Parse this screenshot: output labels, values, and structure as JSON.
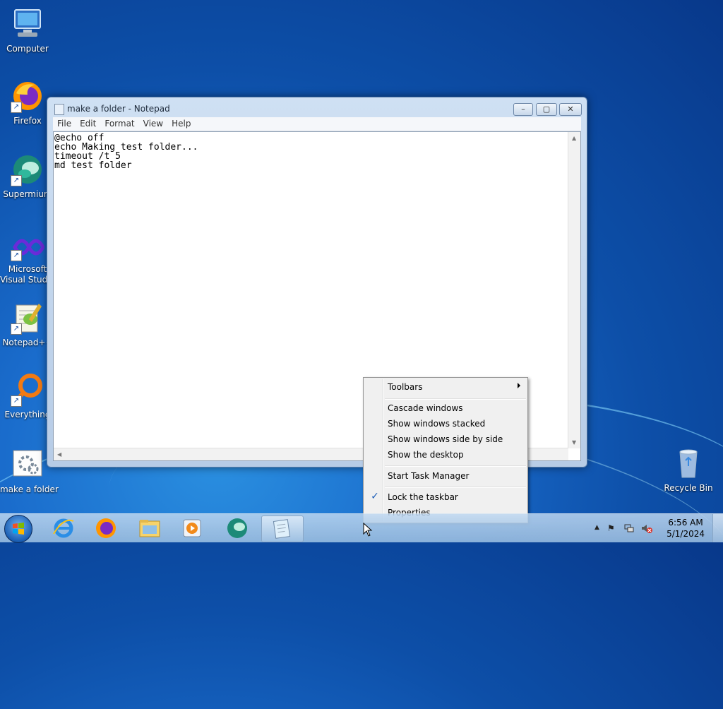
{
  "desktop": {
    "icons": [
      {
        "label": "Computer",
        "icon": "computer-icon"
      },
      {
        "label": "Firefox",
        "icon": "firefox-icon"
      },
      {
        "label": "Supermium",
        "icon": "supermium-icon"
      },
      {
        "label_line1": "Microsoft",
        "label_line2": "Visual Studio",
        "icon": "visual-studio-icon"
      },
      {
        "label": "Notepad++",
        "icon": "notepadpp-icon"
      },
      {
        "label": "Everything",
        "icon": "everything-icon"
      },
      {
        "label": "make a folder",
        "icon": "batch-file-icon"
      },
      {
        "label": "Recycle Bin",
        "icon": "recycle-bin-icon"
      }
    ]
  },
  "notepad": {
    "title": "make a folder - Notepad",
    "menu": [
      "File",
      "Edit",
      "Format",
      "View",
      "Help"
    ],
    "content": "@echo off\necho Making test folder...\ntimeout /t 5\nmd test folder"
  },
  "context_menu": {
    "items": [
      {
        "label": "Toolbars",
        "submenu": true
      },
      {
        "label": "Cascade windows"
      },
      {
        "label": "Show windows stacked"
      },
      {
        "label": "Show windows side by side"
      },
      {
        "label": "Show the desktop"
      },
      {
        "label": "Start Task Manager"
      },
      {
        "label": "Lock the taskbar",
        "checked": true
      },
      {
        "label": "Properties"
      }
    ]
  },
  "taskbar": {
    "pinned": [
      "internet-explorer-icon",
      "firefox-icon",
      "file-explorer-icon",
      "media-player-icon",
      "supermium-icon",
      "notepad-icon"
    ],
    "active_app": "notepad-icon"
  },
  "tray": {
    "time": "6:56 AM",
    "date": "5/1/2024"
  },
  "colors": {
    "accent": "#1f5fb8",
    "desktop": "#0d4fa8"
  }
}
